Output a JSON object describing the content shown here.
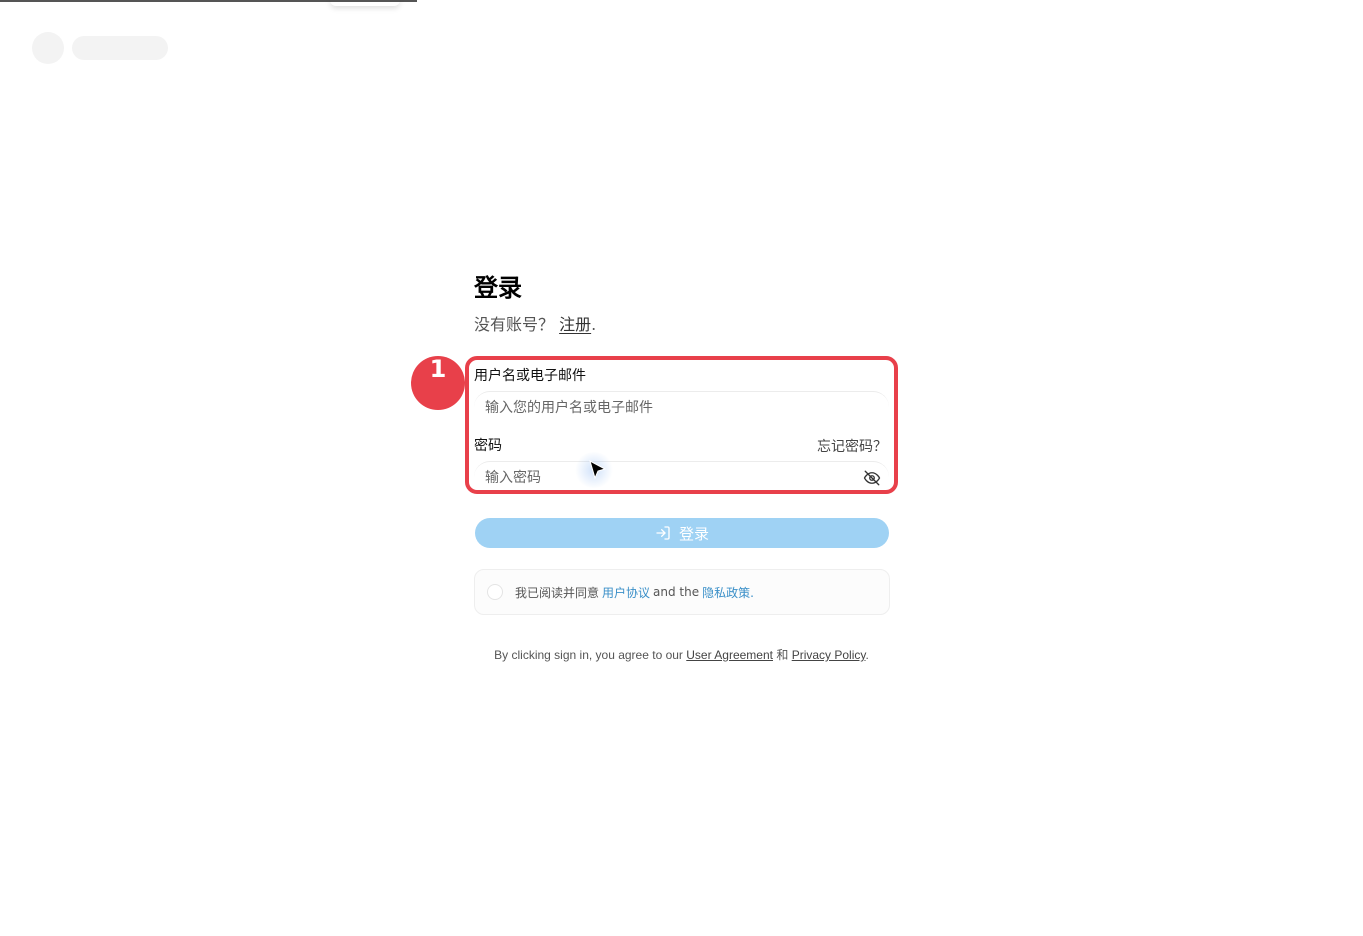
{
  "header": {
    "skeleton": true
  },
  "login": {
    "title": "登录",
    "signup_prompt": "没有账号？",
    "signup_link": "注册",
    "signup_suffix": ".",
    "username_label": "用户名或电子邮件",
    "username_placeholder": "输入您的用户名或电子邮件",
    "password_label": "密码",
    "forgot_link": "忘记密码？",
    "password_placeholder": "输入密码",
    "submit_label": "登录"
  },
  "agreement": {
    "prefix": "我已阅读并同意",
    "user_agreement_link": "用户协议",
    "middle": "and the",
    "privacy_link": "隐私政策.",
    "checked": false
  },
  "footer": {
    "prefix": "By clicking sign in, you agree to our",
    "user_agreement": "User Agreement",
    "conjunction": "和",
    "privacy_policy": "Privacy Policy",
    "suffix": "."
  },
  "annotation": {
    "marker_number": "1",
    "color": "#e8404a"
  },
  "colors": {
    "button_bg": "#9fd2f4",
    "link_blue": "#3a8fc8"
  },
  "icons": {
    "eye": "eye-off-icon",
    "login": "sign-in-icon",
    "cursor": "mouse-pointer-icon"
  }
}
